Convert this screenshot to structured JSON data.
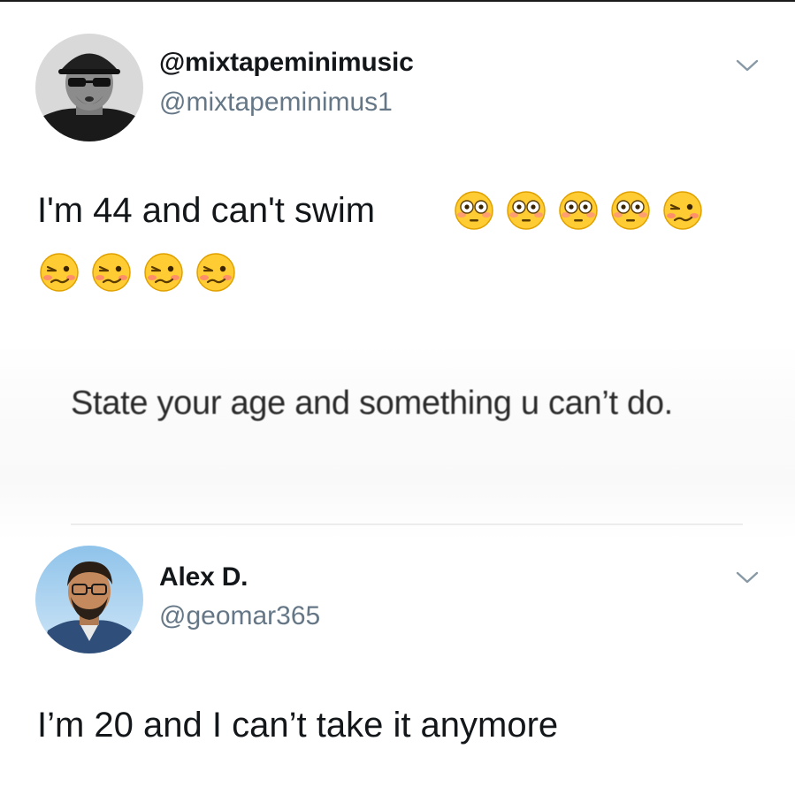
{
  "tweet1": {
    "display_name": "@mixtapeminimusic",
    "handle": "@mixtapeminimus1",
    "text": "I'm 44 and can't swim",
    "emojis_row1": [
      "flushed-face",
      "flushed-face",
      "flushed-face",
      "flushed-face",
      "woozy-face"
    ],
    "emojis_row2": [
      "woozy-face",
      "woozy-face",
      "woozy-face",
      "woozy-face"
    ],
    "avatar": "profile-photo-man-sunglasses"
  },
  "quoted": {
    "text": "State your age and something u can’t do."
  },
  "tweet2": {
    "display_name": "Alex D.",
    "handle": "@geomar365",
    "text": "I’m 20 and I can’t take it anymore",
    "avatar": "profile-photo-man-glasses"
  },
  "colors": {
    "text_primary": "#14171a",
    "text_secondary": "#657786",
    "caret": "#8899a6",
    "emoji_face": "#ffcc33"
  },
  "icons": {
    "more_options": "chevron-down-icon"
  }
}
